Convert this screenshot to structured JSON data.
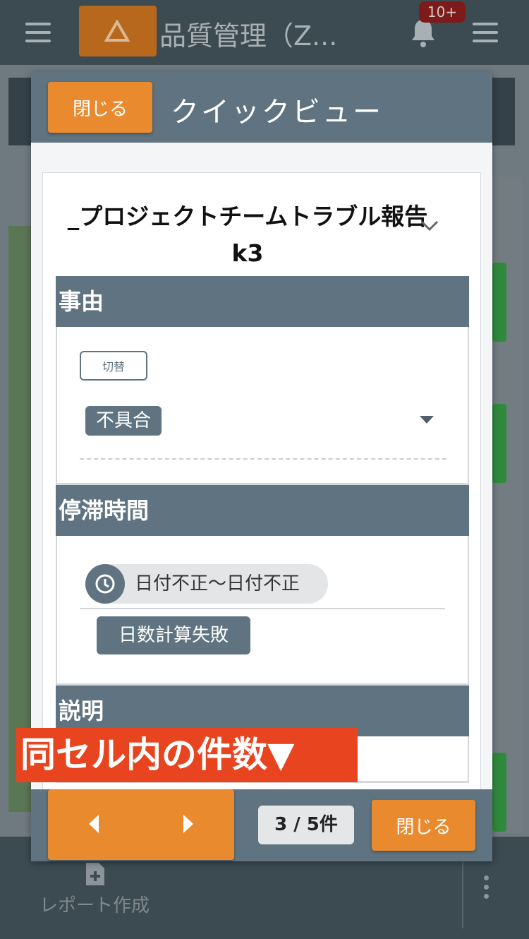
{
  "app": {
    "title": "品質管理（Z...",
    "notification_count": "10+"
  },
  "bottom_bar": {
    "report_label": "レポート作成"
  },
  "quick_view": {
    "header_close_label": "閉じる",
    "title": "クイックビュー",
    "record_title": "_プロジェクトチームトラブル報告k3",
    "sections": {
      "reason": {
        "heading": "事由",
        "toggle_label": "切替",
        "value": "不具合"
      },
      "downtime": {
        "heading": "停滞時間",
        "date_range": "日付不正〜日付不正",
        "days": "日数計算失敗"
      },
      "description": {
        "heading": "説明"
      }
    },
    "overlay_label": "同セル内の件数▼",
    "pager": {
      "count": "3 / 5件"
    },
    "footer_close_label": "閉じる"
  },
  "colors": {
    "header_slate": "#5f7480",
    "accent_orange": "#ea8a2f",
    "overlay_red": "#e8441f",
    "app_bar": "#3c4a52"
  }
}
